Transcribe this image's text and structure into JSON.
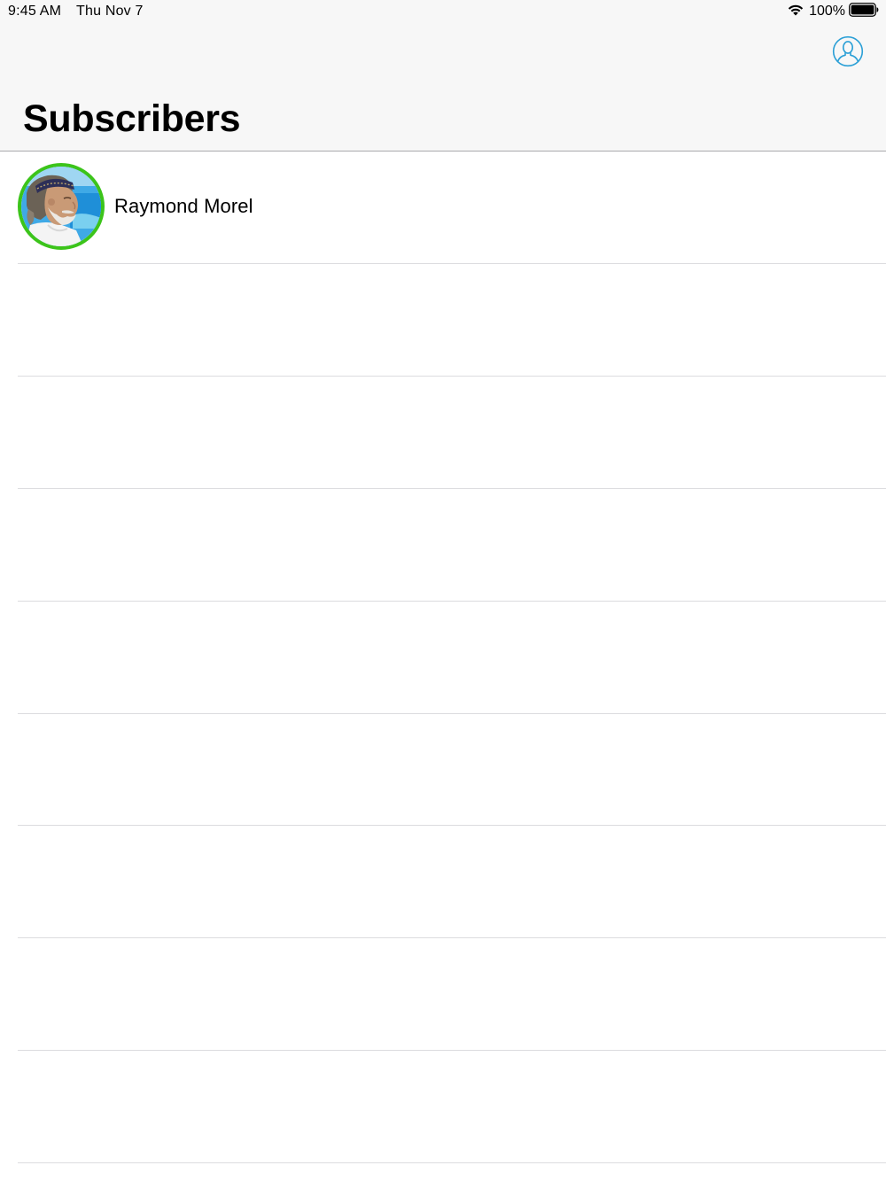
{
  "status_bar": {
    "time": "9:45 AM",
    "date": "Thu Nov 7",
    "battery_percent": "100%",
    "icons": [
      "wifi-icon",
      "battery-icon"
    ]
  },
  "nav_bar": {
    "title": "Subscribers",
    "right_button_icon": "person-circle-icon",
    "accent_color": "#2a9fd6"
  },
  "subscribers": [
    {
      "name": "Raymond Morel",
      "avatar": "person-photo",
      "ring_color": "#3cc41a"
    }
  ],
  "empty_row_count": 8
}
